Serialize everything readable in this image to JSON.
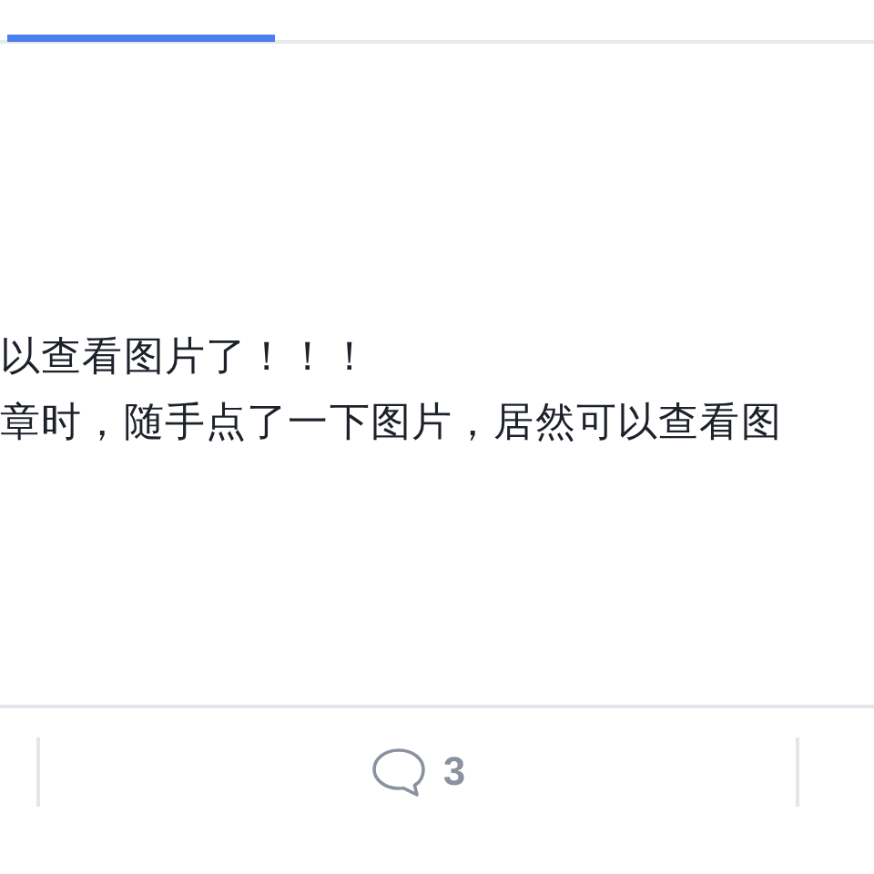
{
  "paragraph_lines": [
    "以查看图片了！！！",
    "章时，随手点了一下图片，居然可以查看图"
  ],
  "action_bar": {
    "comment_count": "3"
  }
}
